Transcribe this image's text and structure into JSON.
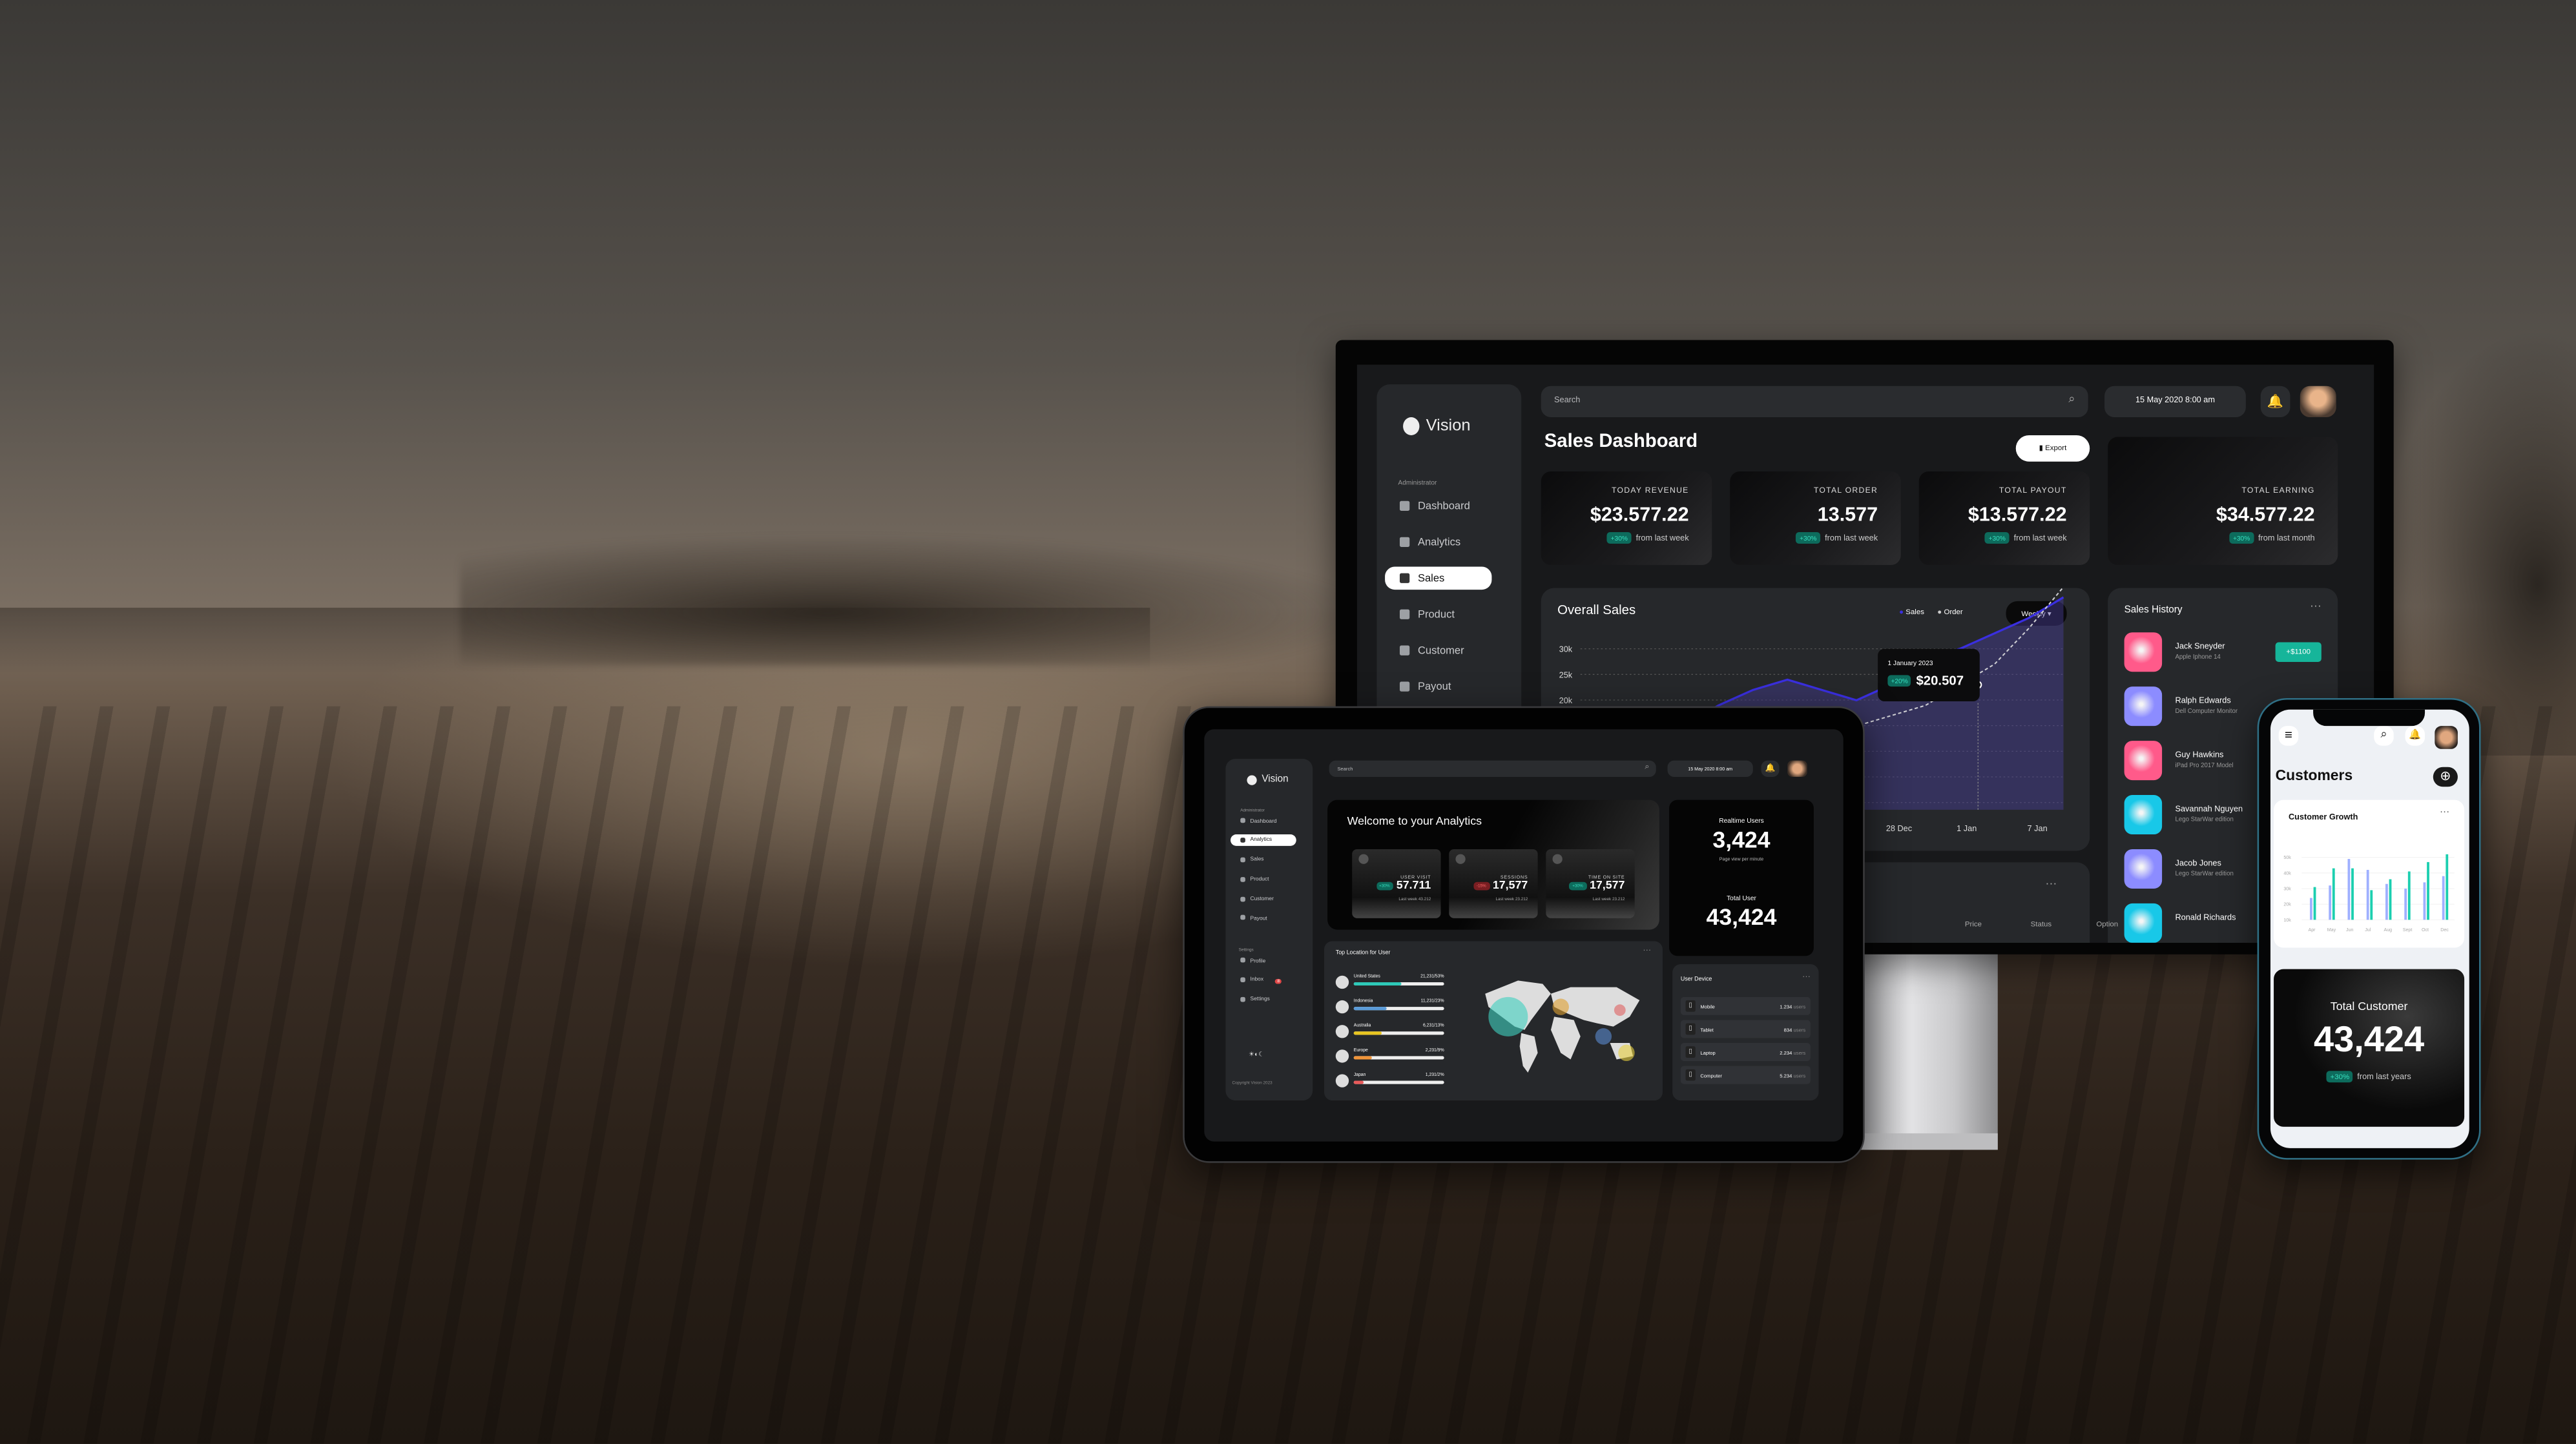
{
  "monitor": {
    "brand": "Vision",
    "sidebar": {
      "section": "Administrator",
      "items": [
        {
          "label": "Dashboard",
          "icon": "dashboard-icon"
        },
        {
          "label": "Analytics",
          "icon": "analytics-icon"
        },
        {
          "label": "Sales",
          "icon": "bar-chart-icon",
          "active": true
        },
        {
          "label": "Product",
          "icon": "product-icon"
        },
        {
          "label": "Customer",
          "icon": "customer-icon"
        },
        {
          "label": "Payout",
          "icon": "payout-icon"
        }
      ]
    },
    "search_placeholder": "Search",
    "datetime": "15 May 2020 8:00 am",
    "title": "Sales Dashboard",
    "export_label": "Export",
    "stats": [
      {
        "label": "TODAY REVENUE",
        "value": "$23.577.22",
        "badge": "+30%",
        "note": "from last week"
      },
      {
        "label": "TOTAL ORDER",
        "value": "13.577",
        "badge": "+30%",
        "note": "from last week"
      },
      {
        "label": "TOTAL PAYOUT",
        "value": "$13.577.22",
        "badge": "+30%",
        "note": "from last week"
      },
      {
        "label": "TOTAL EARNING",
        "value": "$34.577.22",
        "badge": "+30%",
        "note": "from last month"
      }
    ],
    "overall_sales": {
      "title": "Overall Sales",
      "legend": [
        "Sales",
        "Order"
      ],
      "period": "Weekly",
      "y_ticks": [
        "30k",
        "25k",
        "20k"
      ],
      "x_ticks": [
        "28 Dec",
        "1 Jan",
        "7 Jan"
      ],
      "sales": [
        8,
        10,
        12,
        15,
        19,
        22,
        24,
        22,
        20,
        23,
        28,
        30,
        33,
        36,
        40
      ],
      "order": [
        9,
        8,
        7,
        8,
        10,
        12,
        15,
        16,
        15,
        17,
        19,
        23,
        27,
        34,
        42
      ],
      "tooltip": {
        "date": "1 January 2023",
        "badge": "+20%",
        "value": "$20.507"
      },
      "colors": {
        "sales": "#3a2fe0",
        "order": "#cfcfd4"
      }
    },
    "sales_history": {
      "title": "Sales History",
      "items": [
        {
          "name": "Jack Sneyder",
          "product": "Apple Iphone 14",
          "amount": "+$1100",
          "color": "#ff5a8a"
        },
        {
          "name": "Ralph Edwards",
          "product": "Dell Computer Monitor",
          "color": "#8c8cff"
        },
        {
          "name": "Guy Hawkins",
          "product": "iPad Pro 2017 Model",
          "color": "#ff5a8a"
        },
        {
          "name": "Savannah Nguyen",
          "product": "Lego StarWar edition",
          "color": "#18c8e8"
        },
        {
          "name": "Jacob Jones",
          "product": "Lego StarWar edition",
          "color": "#8c8cff"
        },
        {
          "name": "Ronald Richards",
          "product": "",
          "color": "#18c8e8"
        }
      ]
    },
    "table_headers": [
      "Price",
      "Status",
      "Option"
    ]
  },
  "tablet": {
    "brand": "Vision",
    "sidebar": {
      "section": "Administrator",
      "items": [
        {
          "label": "Dashboard"
        },
        {
          "label": "Analytics",
          "active": true
        },
        {
          "label": "Sales"
        },
        {
          "label": "Product"
        },
        {
          "label": "Customer"
        },
        {
          "label": "Payout"
        }
      ],
      "settings_section": "Settings",
      "settings_items": [
        {
          "label": "Profile"
        },
        {
          "label": "Inbox",
          "badge": "8"
        },
        {
          "label": "Settings"
        }
      ],
      "copyright": "Copyright Vision 2023"
    },
    "search_placeholder": "Search",
    "datetime": "15 May 2020 8:00 am",
    "welcome": "Welcome to your Analytics",
    "stats": [
      {
        "label": "USER VISIT",
        "value": "57.711",
        "badge": "+30%",
        "trend": "up",
        "note": "Last week 43.212"
      },
      {
        "label": "SESSIONS",
        "value": "17,577",
        "badge": "-15%",
        "trend": "down",
        "note": "Last week 23.212"
      },
      {
        "label": "TIME ON SITE",
        "value": "17,577",
        "badge": "+30%",
        "trend": "up",
        "note": "Last week 23.212"
      }
    ],
    "realtime": {
      "label": "Realtime Users",
      "value": "3,424",
      "sub": "Page view per minute"
    },
    "total_user": {
      "label": "Total User",
      "value": "43,424"
    },
    "top_location": {
      "title": "Top Location for User",
      "items": [
        {
          "country": "United States",
          "value": "21,231/53%",
          "pct": 53,
          "color": "#2ec9b8"
        },
        {
          "country": "Indonesia",
          "value": "11,231/23%",
          "pct": 37,
          "color": "#5a9bd8"
        },
        {
          "country": "Australia",
          "value": "6,231/13%",
          "pct": 30,
          "color": "#e8c520"
        },
        {
          "country": "Europe",
          "value": "2,231/9%",
          "pct": 20,
          "color": "#f0953a"
        },
        {
          "country": "Japan",
          "value": "1,231/2%",
          "pct": 10,
          "color": "#e85a5a"
        }
      ]
    },
    "user_device": {
      "title": "User Device",
      "items": [
        {
          "device": "Mobile",
          "count": "1.234",
          "unit": "users"
        },
        {
          "device": "Tablet",
          "count": "834",
          "unit": "users"
        },
        {
          "device": "Laptop",
          "count": "2.234",
          "unit": "users"
        },
        {
          "device": "Computer",
          "count": "5.234",
          "unit": "users"
        }
      ]
    }
  },
  "phone": {
    "title": "Customers",
    "growth": {
      "title": "Customer Growth",
      "y_ticks": [
        "50k",
        "40k",
        "30k",
        "20k",
        "10k"
      ],
      "months": [
        "Apr",
        "May",
        "Jun",
        "Jul",
        "Aug",
        "Sept",
        "Oct",
        "Dec"
      ],
      "series_a": [
        24,
        32,
        49,
        42,
        33,
        30,
        34,
        38
      ],
      "series_b": [
        31,
        43,
        43,
        29,
        36,
        41,
        47,
        52
      ],
      "colors": {
        "a": "#9fb0ff",
        "b": "#1ccfb0"
      }
    },
    "total": {
      "label": "Total Customer",
      "value": "43,424",
      "badge": "+30%",
      "note": "from last years"
    }
  }
}
